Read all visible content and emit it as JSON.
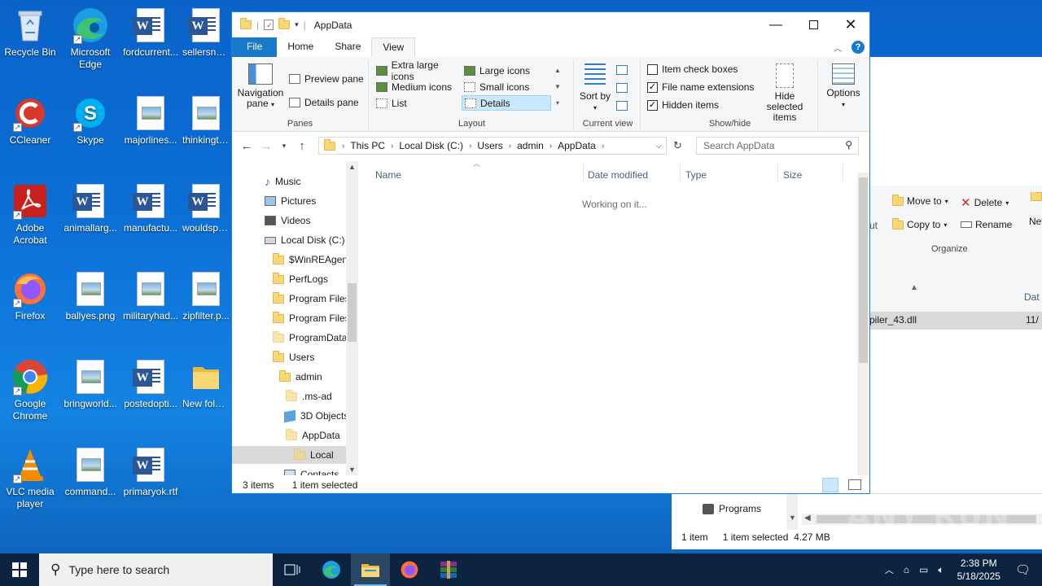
{
  "desktop": {
    "icons": [
      {
        "label": "Recycle Bin"
      },
      {
        "label": "Microsoft Edge"
      },
      {
        "label": "fordcurrent..."
      },
      {
        "label": "sellersnam..."
      },
      {
        "label": "CCleaner"
      },
      {
        "label": "Skype"
      },
      {
        "label": "majorlines..."
      },
      {
        "label": "thinkingtw..."
      },
      {
        "label": "Adobe Acrobat"
      },
      {
        "label": "animallarg..."
      },
      {
        "label": "manufactu..."
      },
      {
        "label": "wouldspe..."
      },
      {
        "label": "Firefox"
      },
      {
        "label": "ballyes.png"
      },
      {
        "label": "militaryhad..."
      },
      {
        "label": "zipfilter.p..."
      },
      {
        "label": "Google Chrome"
      },
      {
        "label": "bringworld..."
      },
      {
        "label": "postedopti..."
      },
      {
        "label": "New folde..."
      },
      {
        "label": "VLC media player"
      },
      {
        "label": "command..."
      },
      {
        "label": "primaryok.rtf"
      }
    ]
  },
  "window": {
    "title": "AppData",
    "tabs": {
      "file": "File",
      "home": "Home",
      "share": "Share",
      "view": "View"
    },
    "ribbon": {
      "panes": {
        "nav_pane": "Navigation pane",
        "preview_pane": "Preview pane",
        "details_pane": "Details pane",
        "group_label": "Panes"
      },
      "layout": {
        "extra_large": "Extra large icons",
        "large": "Large icons",
        "medium": "Medium icons",
        "small": "Small icons",
        "list": "List",
        "details": "Details",
        "group_label": "Layout"
      },
      "current_view": {
        "sort_by": "Sort by",
        "group_label": "Current view"
      },
      "show_hide": {
        "item_check_boxes": "Item check boxes",
        "file_name_extensions": "File name extensions",
        "hidden_items": "Hidden items",
        "hide_selected": "Hide selected items",
        "group_label": "Show/hide"
      },
      "options": "Options"
    },
    "address": {
      "crumbs": [
        "This PC",
        "Local Disk (C:)",
        "Users",
        "admin",
        "AppData"
      ],
      "search_placeholder": "Search AppData"
    },
    "nav_tree": [
      "Music",
      "Pictures",
      "Videos",
      "Local Disk (C:)",
      "$WinREAgent",
      "PerfLogs",
      "Program Files",
      "Program Files",
      "ProgramData",
      "Users",
      "admin",
      ".ms-ad",
      "3D Objects",
      "AppData",
      "Local",
      "Contacts"
    ],
    "columns": {
      "name": "Name",
      "date_modified": "Date modified",
      "type": "Type",
      "size": "Size"
    },
    "working_text": "Working on it...",
    "status": {
      "items": "3 items",
      "selected": "1 item selected"
    }
  },
  "background_window": {
    "move_to": "Move to",
    "delete": "Delete",
    "new_folder": "New folde",
    "copy_to": "Copy to",
    "rename": "Rename",
    "organize": "Organize",
    "col_partial": "Dat",
    "nav_partial": "ut",
    "file_name": "piler_43.dll",
    "file_date": "11/",
    "nav_item": "Programs",
    "status_items": "1 item",
    "status_selected": "1 item selected",
    "status_size": "4.27 MB"
  },
  "taskbar": {
    "search_placeholder": "Type here to search",
    "time": "2:38 PM",
    "date": "5/18/2025"
  },
  "watermark": "ANY RUN",
  "colors": {
    "accent": "#1979ca",
    "selection": "#cce8ff",
    "taskbar": "#0c2440"
  }
}
